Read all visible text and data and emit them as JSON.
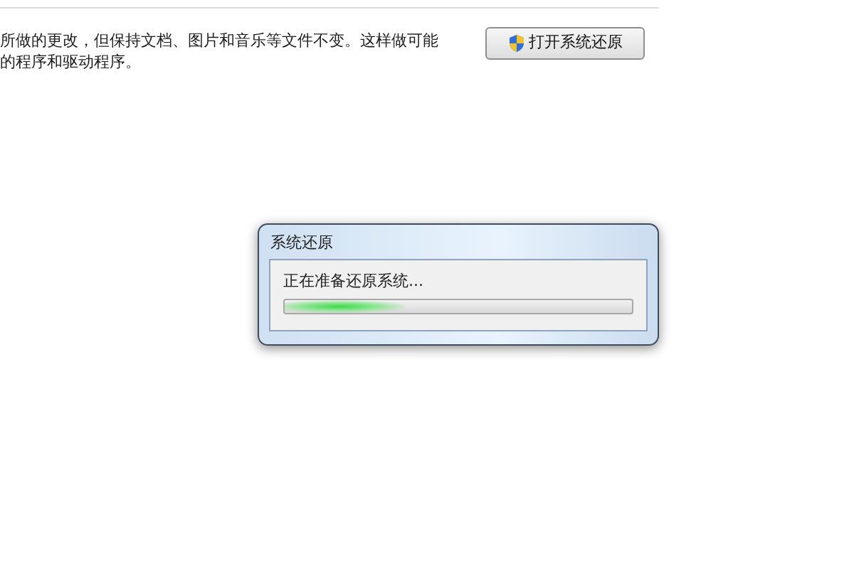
{
  "description": {
    "lines": [
      "所做的更改，但保持文档、图片和音乐等文件不变。这样做可能",
      "的程序和驱动程序。"
    ]
  },
  "open_button": {
    "label": "打开系统还原"
  },
  "dialog": {
    "title": "系统还原",
    "message": "正在准备还原系统...",
    "progress": {
      "kind": "marquee",
      "level": 0.35
    }
  }
}
